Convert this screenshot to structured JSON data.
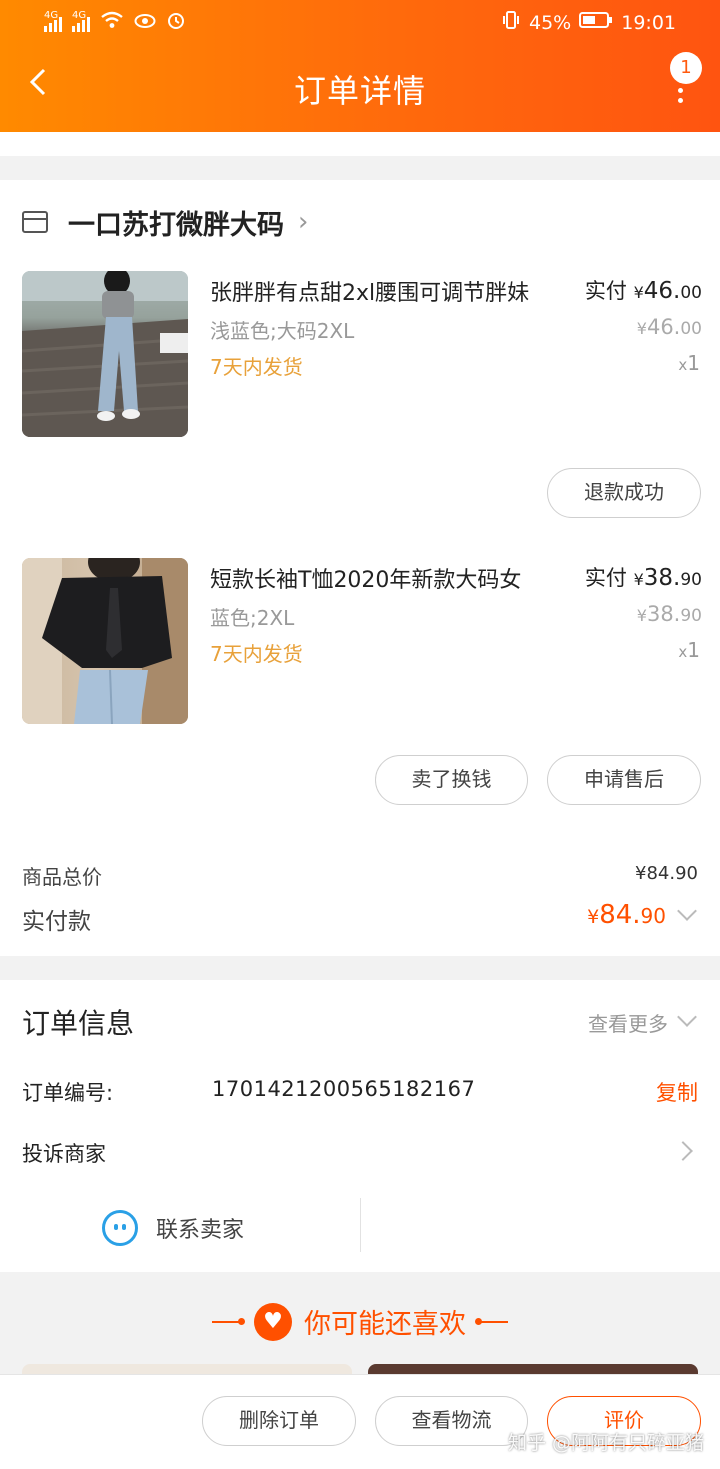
{
  "status_bar": {
    "signal1": "4G",
    "signal2": "4G",
    "battery": "45%",
    "time": "19:01"
  },
  "header": {
    "title": "订单详情",
    "badge_count": "1"
  },
  "shop": {
    "name": "一口苏打微胖大码",
    "items": [
      {
        "title": "张胖胖有点甜2xl腰围可调节胖妹",
        "spec": "浅蓝色;大码2XL",
        "shipping": "7天内发货",
        "paid_label": "实付",
        "currency": "¥",
        "paid_int": "46.",
        "paid_dec": "00",
        "orig_int": "46.",
        "orig_dec": "00",
        "qty_x": "x",
        "qty": "1"
      },
      {
        "title": "短款长袖T恤2020年新款大码女",
        "spec": "蓝色;2XL",
        "shipping": "7天内发货",
        "paid_label": "实付",
        "currency": "¥",
        "paid_int": "38.",
        "paid_dec": "90",
        "orig_int": "38.",
        "orig_dec": "90",
        "qty_x": "x",
        "qty": "1"
      }
    ],
    "refund_button": "退款成功",
    "sell_button": "卖了换钱",
    "aftersale_button": "申请售后"
  },
  "summary": {
    "total_label": "商品总价",
    "total_value": "¥84.90",
    "paid_label": "实付款",
    "paid_currency": "¥",
    "paid_int": "84.",
    "paid_dec": "90"
  },
  "order_info": {
    "title": "订单信息",
    "more_label": "查看更多",
    "order_no_label": "订单编号:",
    "order_no": "1701421200565182167",
    "copy_label": "复制",
    "complain_label": "投诉商家",
    "contact_label": "联系卖家"
  },
  "recommend": {
    "title": "你可能还喜欢"
  },
  "bottom_bar": {
    "delete_button": "删除订单",
    "logistics_button": "查看物流",
    "review_button": "评价"
  },
  "watermark": "知乎 @阿阿有只碎亚猪",
  "colors": {
    "accent": "#ff5000",
    "header_start": "#ff8a00",
    "shipping": "#e8a13a",
    "contact_icon": "#2aa0e6"
  }
}
